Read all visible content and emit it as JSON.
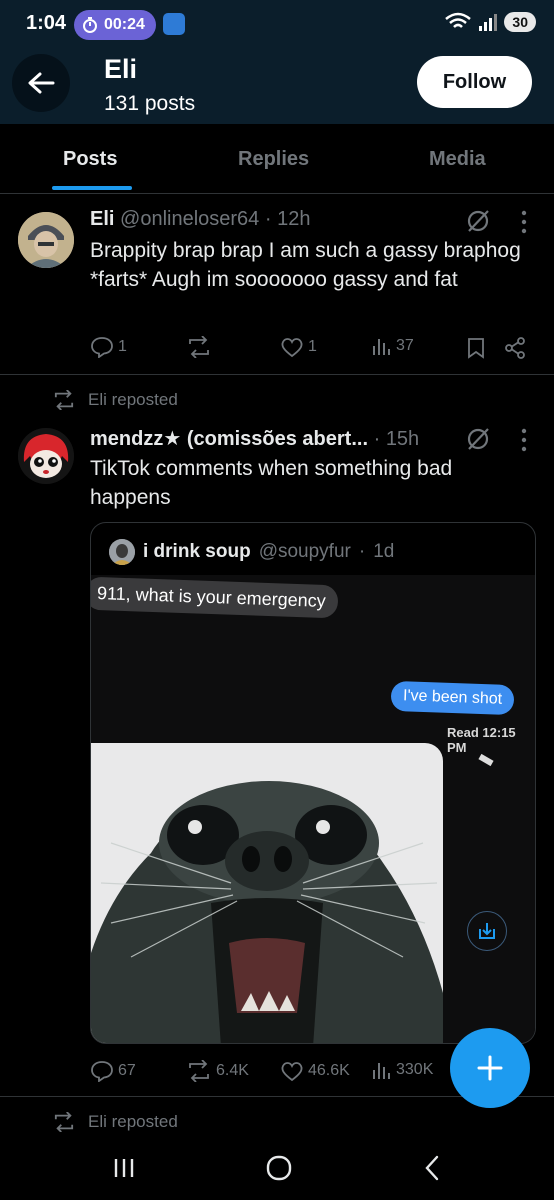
{
  "status_bar": {
    "time": "1:04",
    "timer": "00:24",
    "battery": "30"
  },
  "header": {
    "name": "Eli",
    "posts_count": "131 posts",
    "follow_label": "Follow"
  },
  "tabs": [
    {
      "label": "Posts"
    },
    {
      "label": "Replies"
    },
    {
      "label": "Media"
    }
  ],
  "post1": {
    "author": "Eli",
    "handle": "@onlineloser64",
    "time": "12h",
    "text": "Brappity brap brap I am such a gassy braphog *farts* Augh im sooooooo gassy and fat",
    "replies": "1",
    "reposts": "",
    "likes": "1",
    "views": "37"
  },
  "repost_label": "Eli reposted",
  "post2": {
    "author": "mendzz★ (comissões abert...",
    "time": "15h",
    "text": "TikTok comments when something bad happens",
    "replies": "67",
    "reposts": "6.4K",
    "likes": "46.6K",
    "views": "330K"
  },
  "quote": {
    "author": "i drink soup",
    "handle": "@soupyfur",
    "time": "1d",
    "msg_in": "911, what is your emergency",
    "msg_out": "I've been shot",
    "read_receipt": "Read 12:15 PM"
  },
  "repost_label_2": "Eli reposted",
  "icons": [
    "back-arrow-icon",
    "grok-icon",
    "more-icon",
    "reply-icon",
    "repost-icon",
    "like-icon",
    "views-icon",
    "bookmark-icon",
    "share-icon",
    "download-icon",
    "plus-icon"
  ],
  "colors": {
    "accent": "#1d9bf0",
    "header_bg": "#0b1e2b",
    "muted": "#71767b"
  }
}
